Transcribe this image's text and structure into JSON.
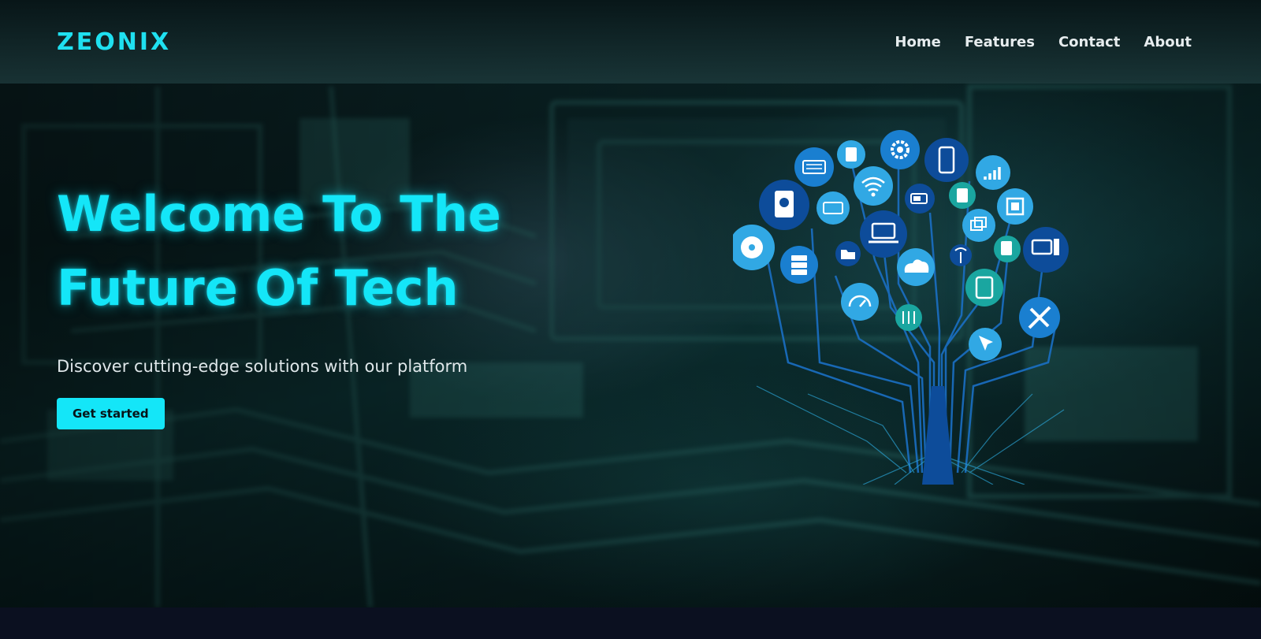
{
  "brand": {
    "name": "ZEONIX"
  },
  "nav": {
    "items": [
      "Home",
      "Features",
      "Contact",
      "About"
    ]
  },
  "hero": {
    "title_line1": "Welcome To The",
    "title_line2": "Future Of Tech",
    "subtitle": "Discover cutting-edge solutions with our platform",
    "cta_label": "Get started"
  },
  "colors": {
    "accent": "#14e6f8",
    "background": "#0b1020",
    "node_dark": "#0d4c9a",
    "node_mid": "#1a7fd0",
    "node_light": "#31a8e4",
    "node_teal": "#1aa6a0"
  },
  "tech_tree": {
    "icons": [
      "keyboard-icon",
      "usb-drive-icon",
      "gear-icon",
      "smartphone-icon",
      "signal-bars-icon",
      "hard-drive-icon",
      "network-card-icon",
      "wifi-icon",
      "battery-icon",
      "sd-card-icon",
      "chip-icon",
      "cd-disc-icon",
      "server-icon",
      "folder-icon",
      "laptop-icon",
      "cloud-icon",
      "windows-icon",
      "antenna-icon",
      "file-icon",
      "desktop-icon",
      "speedometer-icon",
      "sliders-icon",
      "tablet-icon",
      "tools-icon",
      "cursor-icon"
    ]
  }
}
